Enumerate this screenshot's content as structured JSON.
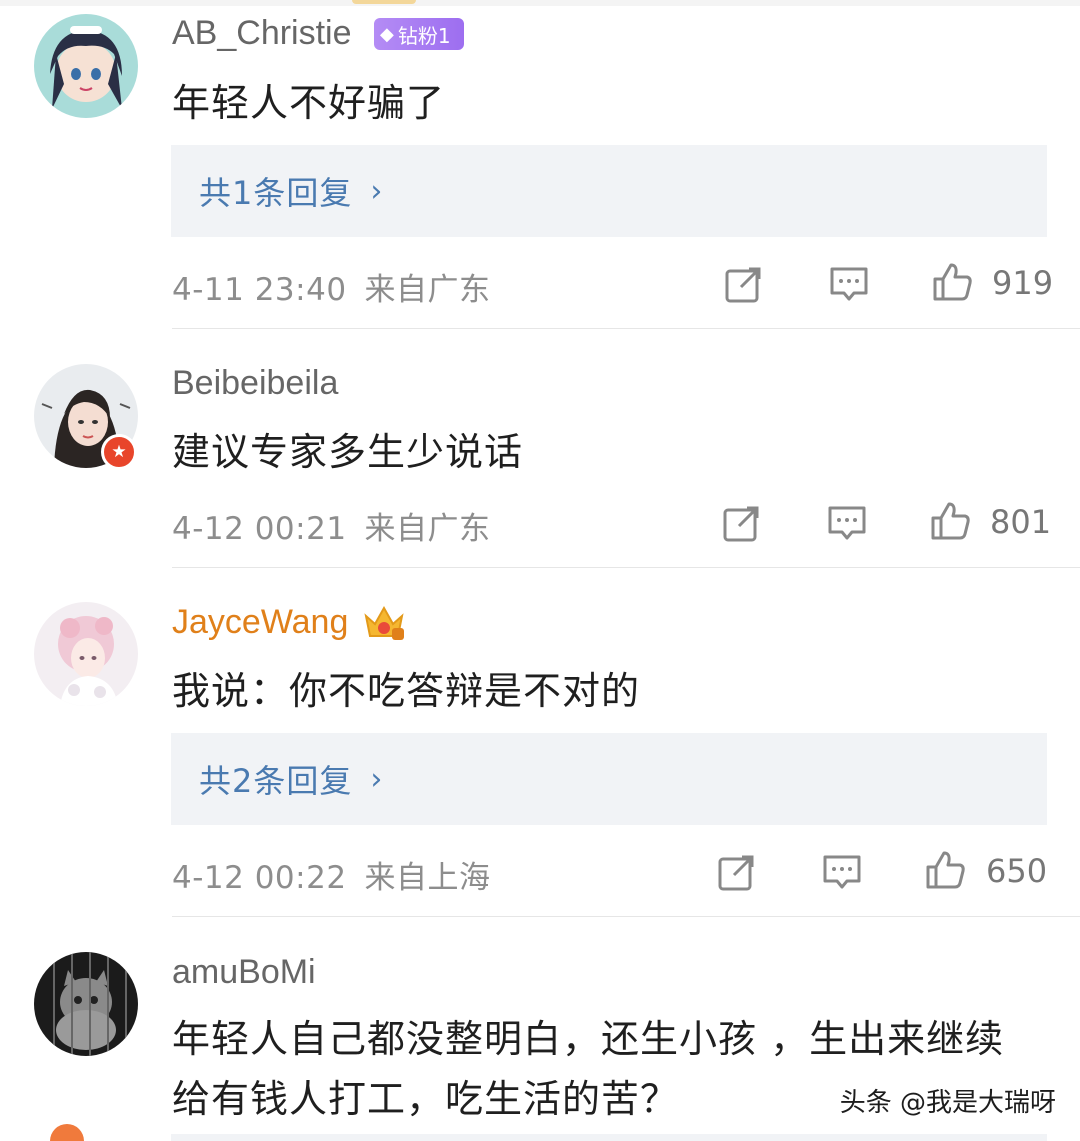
{
  "comments": [
    {
      "username": "AB_Christie",
      "badge": "钻粉1",
      "text": "年轻人不好骗了",
      "reply_label": "共1条回复",
      "time": "4-11 23:40",
      "location": "来自广东",
      "likes": "919"
    },
    {
      "username": "Beibeibeila",
      "text": "建议专家多生少说话",
      "time": "4-12 00:21",
      "location": "来自广东",
      "likes": "801"
    },
    {
      "username": "JayceWang",
      "text": "我说：你不吃答辩是不对的",
      "reply_label": "共2条回复",
      "time": "4-12 00:22",
      "location": "来自上海",
      "likes": "650"
    },
    {
      "username": "amuBoMi",
      "text_line1": "年轻人自己都没整明白，还生小孩 ，生出来继续",
      "text_line2": "给有钱人打工，吃生活的苦？"
    }
  ],
  "icons": {
    "share": "share-icon",
    "comment": "comment-icon",
    "like": "thumbs-up-icon",
    "reply_chevron": "›",
    "verified_star": "★"
  },
  "watermark": "头条 @我是大瑞呀",
  "colors": {
    "reply_link": "#4a7ab0",
    "gold_name": "#e0801a",
    "fan_badge": "#a57af2"
  }
}
